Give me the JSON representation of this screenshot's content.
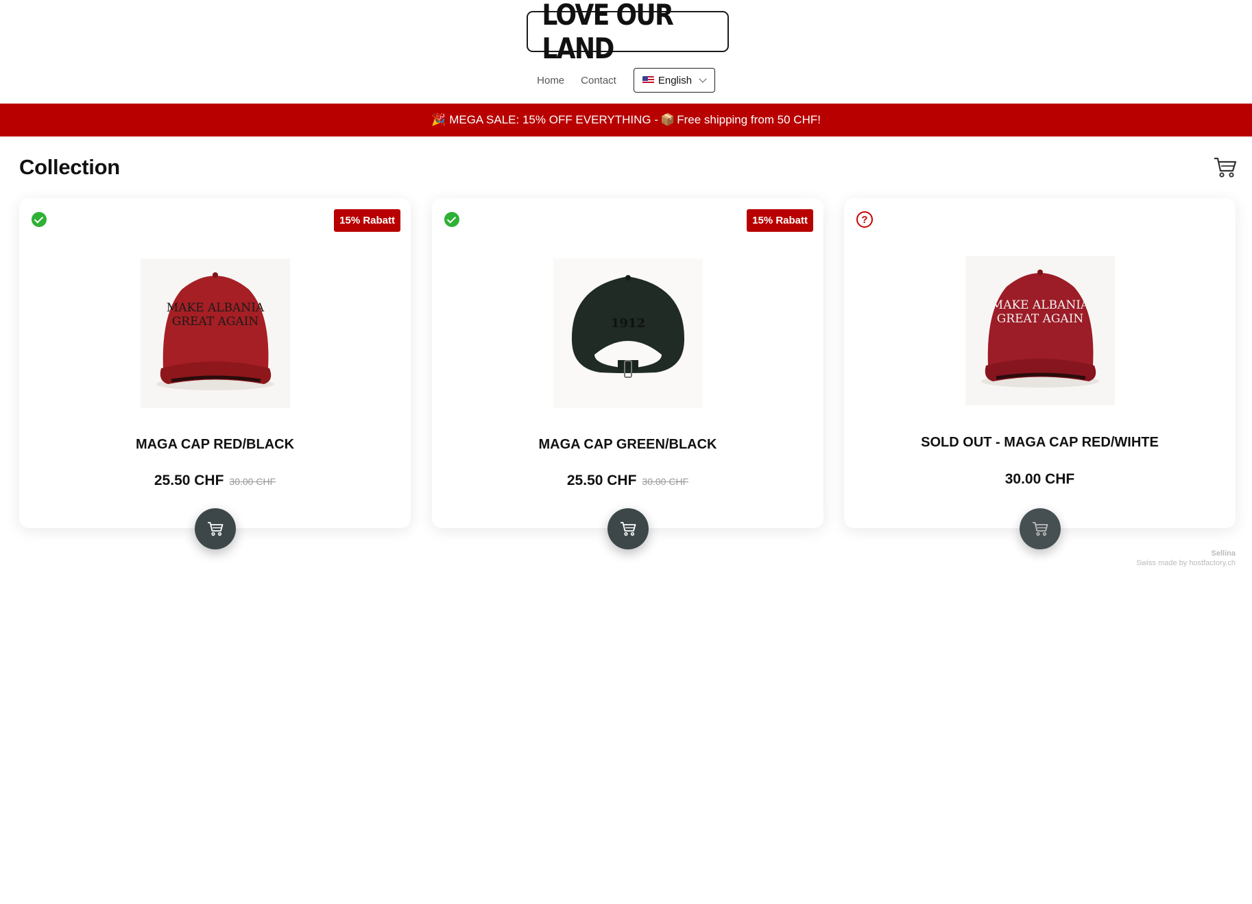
{
  "header": {
    "logo_text": "LOVE OUR LAND",
    "nav": [
      {
        "label": "Home"
      },
      {
        "label": "Contact"
      }
    ],
    "language": {
      "label": "English",
      "flag_icon": "us-flag-icon"
    }
  },
  "banner": {
    "text_1": "MEGA SALE: 15% OFF EVERYTHING - ",
    "text_2": "Free shipping from 50 CHF!",
    "emoji_1": "🎉",
    "emoji_2": "📦",
    "background": "#b80000"
  },
  "collection": {
    "title": "Collection",
    "cart_icon": "cart-icon"
  },
  "products": [
    {
      "name": "MAGA CAP RED/BLACK",
      "price": "25.50 CHF",
      "old_price": "30.00 CHF",
      "badge": "15% Rabatt",
      "status_icon": "check-icon",
      "image": {
        "cap_color": "#a51f24",
        "text_color": "#1a1a1a",
        "line_1": "MAKE ALBANIA",
        "line_2": "GREAT AGAIN"
      }
    },
    {
      "name": "MAGA CAP GREEN/BLACK",
      "price": "25.50 CHF",
      "old_price": "30.00 CHF",
      "badge": "15% Rabatt",
      "status_icon": "check-icon",
      "image": {
        "cap_color": "#1f2b24",
        "text_color": "#111111",
        "line_1": "1912"
      }
    },
    {
      "name": "SOLD OUT - MAGA CAP RED/WIHTE",
      "price": "30.00 CHF",
      "status_icon": "question-icon",
      "image": {
        "cap_color": "#9c1c27",
        "text_color": "#f2f2f2",
        "line_1": "MAKE ALBANIA",
        "line_2": "GREAT AGAIN"
      }
    }
  ],
  "footer": {
    "brand": "Sellina",
    "credit": "Swiss made by hostfactory.ch"
  }
}
